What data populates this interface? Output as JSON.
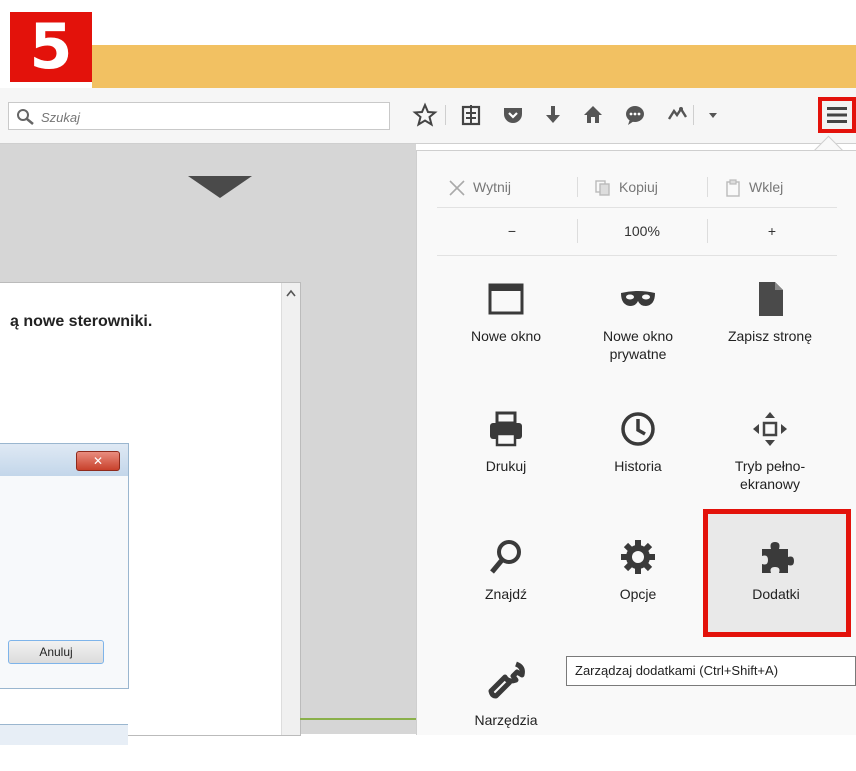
{
  "step": {
    "number": "5"
  },
  "search": {
    "value": "",
    "placeholder": "Szukaj"
  },
  "toolbar": {
    "icons": [
      "star-icon",
      "reading-list-icon",
      "pocket-icon",
      "download-icon",
      "home-icon",
      "chat-icon",
      "extension-icon",
      "dropdown-arrow-icon",
      "hamburger-menu-icon"
    ]
  },
  "dialog": {
    "text": "ą nowe sterowniki.",
    "close_label": "✕",
    "cancel_label": "Anuluj"
  },
  "menu": {
    "edit": {
      "cut": "Wytnij",
      "copy": "Kopiuj",
      "paste": "Wklej"
    },
    "zoom": {
      "out": "−",
      "level": "100%",
      "in": "+"
    },
    "tiles": [
      {
        "label": "Nowe okno",
        "icon": "window-icon"
      },
      {
        "label": "Nowe okno prywatne",
        "icon": "mask-icon"
      },
      {
        "label": "Zapisz stronę",
        "icon": "page-icon"
      },
      {
        "label": "Drukuj",
        "icon": "printer-icon"
      },
      {
        "label": "Historia",
        "icon": "clock-icon"
      },
      {
        "label": "Tryb pełno-ekranowy",
        "icon": "fullscreen-icon"
      },
      {
        "label": "Znajdź",
        "icon": "magnifier-icon"
      },
      {
        "label": "Opcje",
        "icon": "gear-icon"
      },
      {
        "label": "Dodatki",
        "icon": "puzzle-icon"
      },
      {
        "label": "Narzędzia",
        "icon": "wrench-icon"
      }
    ]
  },
  "tooltip": {
    "text": "Zarządzaj dodatkami (Ctrl+Shift+A)"
  },
  "colors": {
    "highlight": "#e3120b",
    "title_strip": "#f2c162"
  }
}
